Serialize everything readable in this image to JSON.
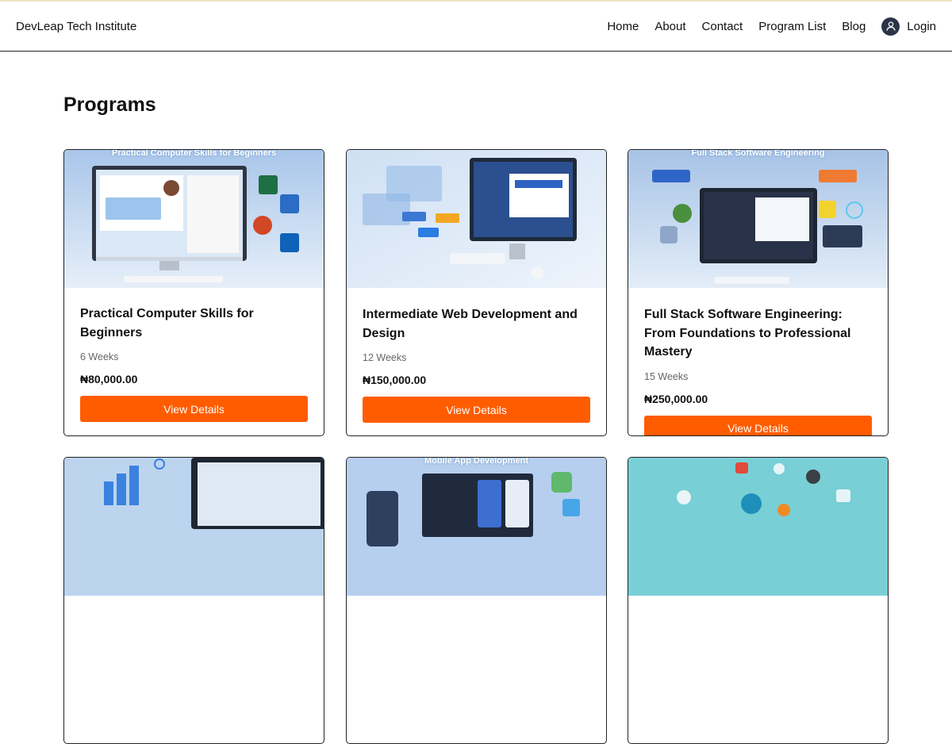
{
  "navbar": {
    "brand": "DevLeap Tech Institute",
    "links": [
      "Home",
      "About",
      "Contact",
      "Program List",
      "Blog"
    ],
    "login_label": "Login",
    "login_icon": "user-avatar-icon"
  },
  "page": {
    "title": "Programs"
  },
  "programs": [
    {
      "title": "Practical Computer Skills for Beginners",
      "image_caption": "Practical Computer Skills for Beginners",
      "duration": "6 Weeks",
      "price": "₦80,000.00",
      "button": "View Details"
    },
    {
      "title": "Intermediate Web Development and Design",
      "duration": "12 Weeks",
      "price": "₦150,000.00",
      "button": "View Details"
    },
    {
      "title": "Full Stack Software Engineering: From Foundations to Professional Mastery",
      "image_caption": "Full Stack Software Engineering",
      "duration": "15 Weeks",
      "price": "₦250,000.00",
      "button": "View Details"
    },
    {
      "title": "",
      "image_caption": ""
    },
    {
      "title": "",
      "image_caption": "Mobile App Development"
    },
    {
      "title": "",
      "image_caption": ""
    }
  ],
  "colors": {
    "accent": "#ff5c00",
    "text": "#111111",
    "muted": "#666666",
    "border": "#222222"
  }
}
